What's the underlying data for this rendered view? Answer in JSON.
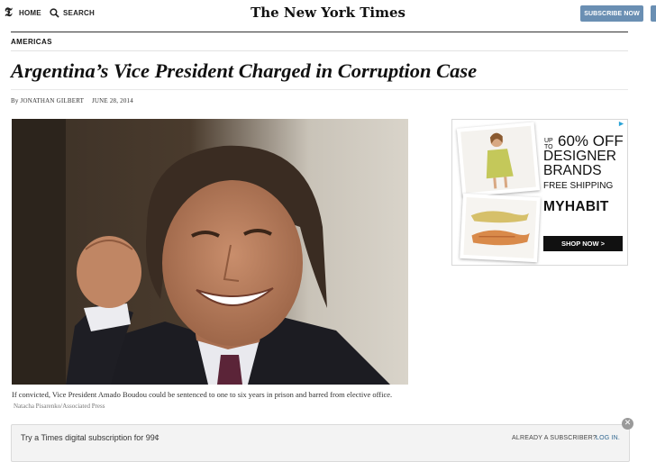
{
  "header": {
    "logo_glyph": "𝕿",
    "home_label": "HOME",
    "search_label": "SEARCH",
    "masthead": "The New York Times",
    "subscribe_label": "SUBSCRIBE NOW",
    "icons": [
      "nyt-t-logo-icon",
      "search-icon"
    ]
  },
  "article": {
    "section": "AMERICAS",
    "headline": "Argentina’s Vice President Charged in Corruption Case",
    "byline": "By JONATHAN GILBERT",
    "date": "JUNE 28, 2014",
    "caption": "If convicted, Vice President Amado Boudou could be sentenced to one to six years in prison and barred from elective office.",
    "credit": "Natacha Pisarenko/Associated Press"
  },
  "ad": {
    "upto_line1": "UP",
    "upto_line2": "TO",
    "discount": "60% OFF",
    "line_designer": "DESIGNER",
    "line_brands": "BRANDS",
    "shipping": "FREE SHIPPING",
    "brand": "MYHABIT",
    "cta": "SHOP NOW >"
  },
  "subscription_bar": {
    "offer": "Try a Times digital subscription for 99¢",
    "already": "ALREADY A SUBSCRIBER?",
    "login": "LOG IN."
  },
  "colors": {
    "subscribe_button": "#6a8fb3",
    "link_blue": "#326891",
    "ad_cta": "#111111"
  }
}
